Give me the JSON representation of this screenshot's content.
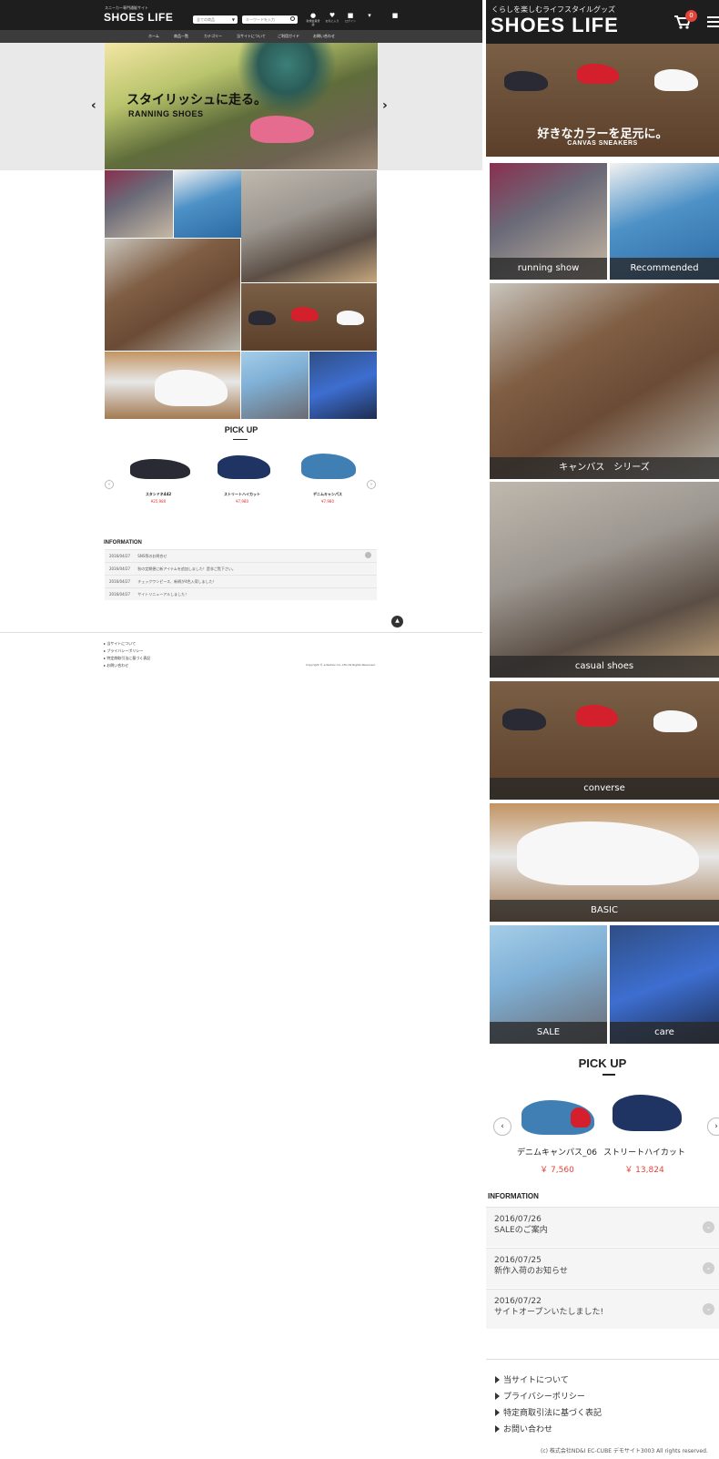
{
  "desktop": {
    "header": {
      "tagline": "スニーカー専門通販サイト",
      "logo": "SHOES LIFE",
      "category_select": "全ての商品",
      "search_placeholder": "キーワードを入力",
      "icons": [
        {
          "label": "新規会員登録",
          "icon": "user-icon"
        },
        {
          "label": "お気に入り",
          "icon": "heart-icon"
        },
        {
          "label": "ログイン",
          "icon": "lock-icon"
        },
        {
          "label": "",
          "icon": "cart-icon"
        },
        {
          "label": "",
          "icon": "lock-icon"
        }
      ]
    },
    "nav": [
      "ホーム",
      "商品一覧",
      "カテゴリー",
      "当サイトについて",
      "ご利用ガイド",
      "お問い合わせ"
    ],
    "hero": {
      "jp": "スタイリッシュに走る。",
      "en": "RANNING SHOES"
    },
    "pickup": {
      "title": "PICK UP",
      "products": [
        {
          "name": "スタンドネ442",
          "price": "¥25,980"
        },
        {
          "name": "ストリートハイカット",
          "price": "¥7,980"
        },
        {
          "name": "デニムキャンパス",
          "price": "¥7,980"
        }
      ]
    },
    "information": {
      "title": "INFORMATION",
      "items": [
        {
          "date": "2016/04/27",
          "text": "SNS等のお問合せ"
        },
        {
          "date": "2016/04/27",
          "text": "秋の定期便に新アイテムを追加しました！是非ご覧下さい。"
        },
        {
          "date": "2016/04/27",
          "text": "チェックワンピース、新柄が4色入荷しました！"
        },
        {
          "date": "2016/04/27",
          "text": "サイトリニューアルしました！"
        }
      ]
    },
    "footer": {
      "links": [
        "当サイトについて",
        "プライバシーポリシー",
        "特定商取引法に基づく表記",
        "お問い合わせ"
      ],
      "copyright": "Copyright © e-fashion Co.,LTD All Rights Reserved."
    }
  },
  "mobile": {
    "header": {
      "tagline": "くらしを楽しむライフスタイルグッズ",
      "logo": "SHOES LIFE",
      "cart_count": "0"
    },
    "banner": {
      "jp": "好きなカラーを足元に。",
      "en": "CANVAS SNEAKERS"
    },
    "categories": [
      "running show",
      "Recommended",
      "キャンバス　シリーズ",
      "casual shoes",
      "converse",
      "BASIC",
      "SALE",
      "care"
    ],
    "pickup": {
      "title": "PICK UP",
      "products": [
        {
          "name": "デニムキャンパス_06",
          "price": "￥ 7,560"
        },
        {
          "name": "ストリートハイカット",
          "price": "￥ 13,824"
        }
      ]
    },
    "information": {
      "title": "INFORMATION",
      "items": [
        {
          "date": "2016/07/26",
          "text": "SALEのご案内"
        },
        {
          "date": "2016/07/25",
          "text": "新作入荷のお知らせ"
        },
        {
          "date": "2016/07/22",
          "text": "サイトオープンいたしました!"
        }
      ]
    },
    "footer": {
      "links": [
        "当サイトについて",
        "プライバシーポリシー",
        "特定商取引法に基づく表記",
        "お問い合わせ"
      ],
      "copyright": "(c) 株式会社ND&I EC-CUBE デモサイト3003 All rights reserved."
    }
  },
  "colors": {
    "header_bg": "#1e1e1e",
    "nav_bg": "#3c3c3c",
    "price_red": "#e0443a",
    "hero_band": "#e9e9e9"
  }
}
